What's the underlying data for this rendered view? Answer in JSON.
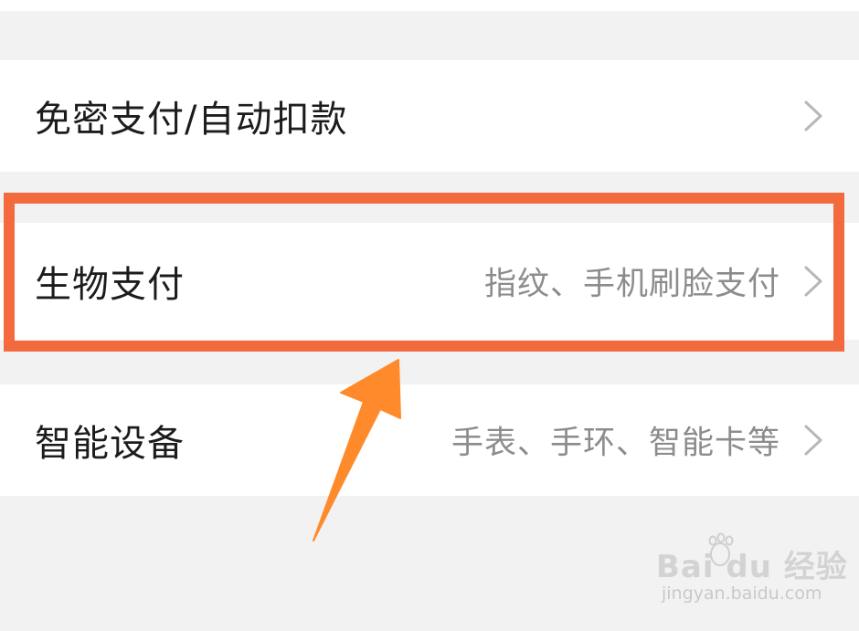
{
  "rows": [
    {
      "title": "免密支付/自动扣款",
      "desc": ""
    },
    {
      "title": "生物支付",
      "desc": "指纹、手机刷脸支付"
    },
    {
      "title": "智能设备",
      "desc": "手表、手环、智能卡等"
    }
  ],
  "annotation": {
    "highlight_color": "#f36a3e",
    "arrow_color": "#ff8a2b",
    "highlighted_row": "生物支付"
  },
  "watermark": {
    "brand_text": "Bai du 经验",
    "url": "jingyan.baidu.com"
  },
  "icons": {
    "row_chevron": "chevron-right-icon",
    "pointer_arrow": "arrow-pointer-icon",
    "watermark_paw": "paw-icon"
  }
}
